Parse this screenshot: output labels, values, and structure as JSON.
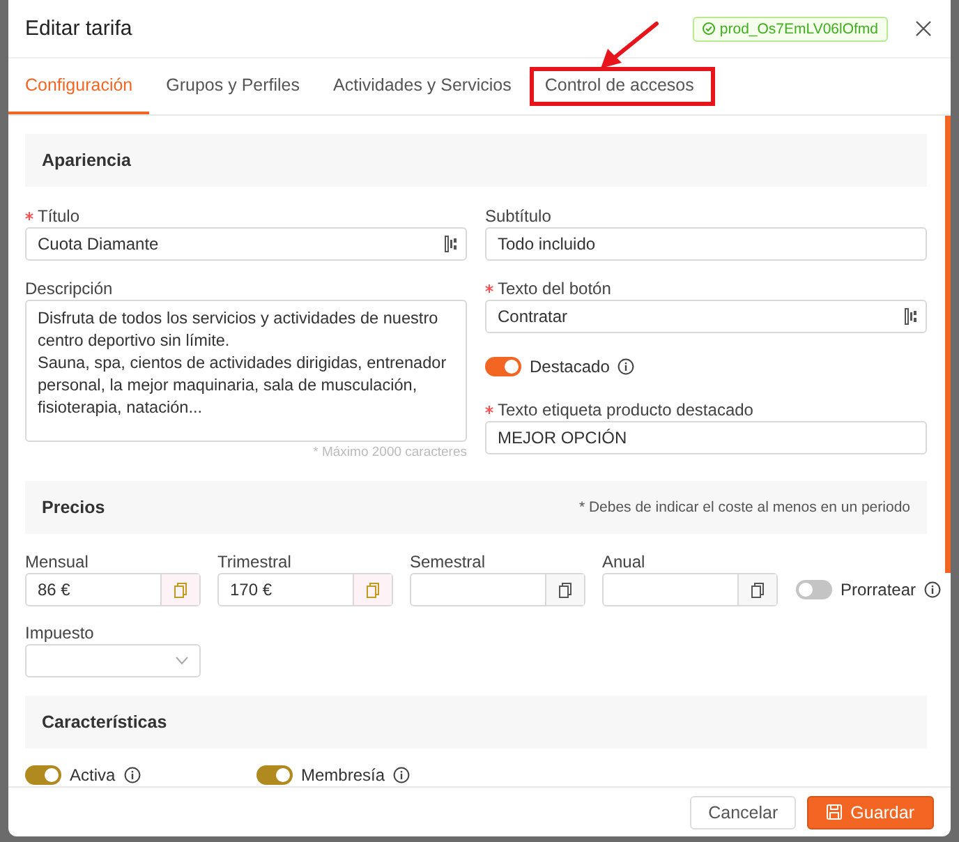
{
  "window": {
    "title": "Editar tarifa",
    "product_id": "prod_Os7EmLV06lOfmd"
  },
  "tabs": [
    {
      "label": "Configuración",
      "selected": true,
      "highlighted": false
    },
    {
      "label": "Grupos y Perfiles",
      "selected": false,
      "highlighted": false
    },
    {
      "label": "Actividades y Servicios",
      "selected": false,
      "highlighted": false
    },
    {
      "label": "Control de accesos",
      "selected": false,
      "highlighted": true
    }
  ],
  "appearance": {
    "heading": "Apariencia",
    "title": {
      "label": "Título",
      "required": true,
      "value": "Cuota Diamante"
    },
    "subtitle": {
      "label": "Subtítulo",
      "required": false,
      "value": "Todo incluido"
    },
    "description": {
      "label": "Descripción",
      "value": "Disfruta de todos los servicios y actividades de nuestro centro deportivo sin límite.\nSauna, spa, cientos de actividades dirigidas, entrenador personal, la mejor maquinaria, sala de musculación, fisioterapia, natación...",
      "hint": "* Máximo 2000 caracteres"
    },
    "button_text": {
      "label": "Texto del botón",
      "required": true,
      "value": "Contratar"
    },
    "featured": {
      "label": "Destacado",
      "on": true
    },
    "featured_label": {
      "label": "Texto etiqueta producto destacado",
      "required": true,
      "value": "MEJOR OPCIÓN"
    }
  },
  "prices": {
    "heading": "Precios",
    "note": "* Debes de indicar el coste al menos en un periodo",
    "periods": [
      {
        "label": "Mensual",
        "value": "86 €"
      },
      {
        "label": "Trimestral",
        "value": "170 €"
      },
      {
        "label": "Semestral"
      },
      {
        "label": "Anual"
      }
    ],
    "prorate": {
      "label": "Prorratear",
      "on": false
    },
    "tax": {
      "label": "Impuesto"
    }
  },
  "features": {
    "heading": "Características",
    "toggles": [
      {
        "label": "Activa",
        "on": true
      },
      {
        "label": "Membresía",
        "on": true
      }
    ]
  },
  "footer": {
    "buttons": [
      {
        "label": "Cancelar",
        "kind": "secondary"
      },
      {
        "label": "Guardar",
        "kind": "primary"
      }
    ]
  }
}
